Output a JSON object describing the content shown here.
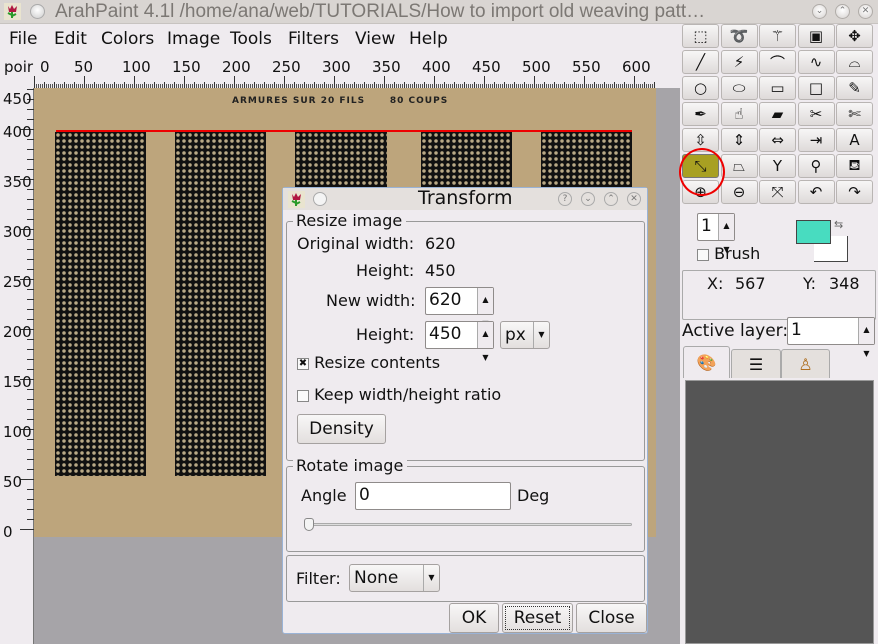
{
  "window": {
    "title": "ArahPaint 4.1l /home/ana/web/TUTORIALS/How to import old weaving patt…",
    "controls": [
      "minimize",
      "maximize",
      "close"
    ]
  },
  "menu": [
    "File",
    "Edit",
    "Colors",
    "Image",
    "Tools",
    "Filters",
    "View",
    "Help"
  ],
  "ruler": {
    "unit_label": "poir",
    "top_ticks": [
      "0",
      "50",
      "100",
      "150",
      "200",
      "250",
      "300",
      "350",
      "400",
      "450",
      "500",
      "550",
      "600"
    ],
    "left_ticks": [
      "450",
      "400",
      "350",
      "300",
      "250",
      "200",
      "150",
      "100",
      "50",
      "0"
    ]
  },
  "canvas": {
    "caption": "ARMURES SUR 20 FILS      80 COUPS",
    "paper_color": "#bda57c",
    "guide_color": "#ee0000"
  },
  "toolbox": {
    "tools": [
      {
        "name": "rect-select",
        "glyph": "⬚"
      },
      {
        "name": "lasso",
        "glyph": "➰"
      },
      {
        "name": "magic-wand",
        "glyph": "⚚"
      },
      {
        "name": "crop",
        "glyph": "▣"
      },
      {
        "name": "move",
        "glyph": "✥"
      },
      {
        "name": "line",
        "glyph": "╱"
      },
      {
        "name": "polyline",
        "glyph": "⚡"
      },
      {
        "name": "curve",
        "glyph": "⌒"
      },
      {
        "name": "freehand-curve",
        "glyph": "∿"
      },
      {
        "name": "bezier",
        "glyph": "⌓"
      },
      {
        "name": "circle",
        "glyph": "○"
      },
      {
        "name": "ellipse",
        "glyph": "⬭"
      },
      {
        "name": "rectangle",
        "glyph": "▭"
      },
      {
        "name": "square",
        "glyph": "□"
      },
      {
        "name": "pencil",
        "glyph": "✎"
      },
      {
        "name": "color-picker",
        "glyph": "✒"
      },
      {
        "name": "smudge",
        "glyph": "☝"
      },
      {
        "name": "eraser",
        "glyph": "▰"
      },
      {
        "name": "cut",
        "glyph": "✂"
      },
      {
        "name": "scissors",
        "glyph": "✄"
      },
      {
        "name": "flip",
        "glyph": "⇳"
      },
      {
        "name": "stretch-vertical",
        "glyph": "⇕"
      },
      {
        "name": "stretch-horizontal",
        "glyph": "⇔"
      },
      {
        "name": "shrink",
        "glyph": "⇥"
      },
      {
        "name": "text",
        "glyph": "A"
      },
      {
        "name": "transform",
        "glyph": "⤡"
      },
      {
        "name": "perspective",
        "glyph": "⏢"
      },
      {
        "name": "split",
        "glyph": "Y"
      },
      {
        "name": "compass",
        "glyph": "⚲"
      },
      {
        "name": "fill-bucket",
        "glyph": "⛾"
      },
      {
        "name": "zoom-in",
        "glyph": "⊕"
      },
      {
        "name": "zoom-out",
        "glyph": "⊖"
      },
      {
        "name": "fit",
        "glyph": "⤧"
      },
      {
        "name": "undo",
        "glyph": "↶"
      },
      {
        "name": "redo",
        "glyph": "↷"
      }
    ],
    "active_tool": "transform"
  },
  "side": {
    "brush_size": "1",
    "brush_label": "Brush",
    "brush_checked": false,
    "fg_color": "#48dcc0",
    "bg_color": "#ffffff",
    "x_label": "X:",
    "x_value": "567",
    "y_label": "Y:",
    "y_value": "348",
    "active_layer_label": "Active layer:",
    "active_layer_value": "1",
    "tabs": [
      "palette",
      "layers",
      "stamp"
    ]
  },
  "dialog": {
    "title": "Transform",
    "resize_group": "Resize image",
    "orig_width_label": "Original width:",
    "orig_width": "620",
    "orig_height_label": "Height:",
    "orig_height": "450",
    "new_width_label": "New width:",
    "new_width": "620",
    "new_height_label": "Height:",
    "new_height": "450",
    "unit": "px",
    "resize_contents_label": "Resize contents",
    "resize_contents_checked": true,
    "keep_ratio_label": "Keep width/height ratio",
    "keep_ratio_checked": false,
    "density_button": "Density",
    "rotate_group": "Rotate image",
    "angle_label": "Angle",
    "angle_value": "0",
    "angle_unit": "Deg",
    "angle_slider_fraction": 0,
    "filter_label": "Filter:",
    "filter_value": "None",
    "ok_button": "OK",
    "reset_button": "Reset",
    "close_button": "Close"
  }
}
